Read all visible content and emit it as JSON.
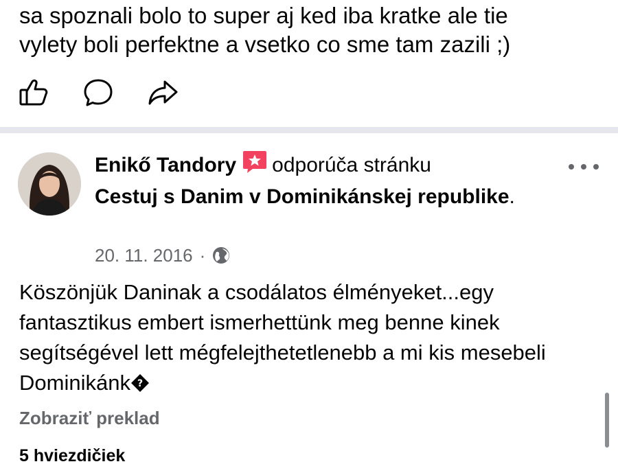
{
  "previous_post": {
    "text": "sa spoznali bolo to super aj ked iba kratke ale tie\nvylety boli perfektne a vsetko co sme tam zazili ;)"
  },
  "actions": [
    {
      "name": "like-icon"
    },
    {
      "name": "comment-icon"
    },
    {
      "name": "share-icon"
    }
  ],
  "review": {
    "author": "Enikő Tandory",
    "verb": "odporúča stránku",
    "page_name": "Cestuj s Danim v Dominikánskej republike",
    "page_suffix": ".",
    "date": "20. 11. 2016",
    "separator": "·",
    "privacy_icon": "globe-icon",
    "text": "Köszönjük Daninak a csodálatos élményeket...egy fantasztikus embert  ismerhettünk meg benne kinek segítségével lett mégfelejthetetlenebb a mi kis mesebeli Dominikánk",
    "translate_label": "Zobraziť preklad",
    "rating_label": "5 hviezdičiek"
  },
  "colors": {
    "recommend_badge": "#f3425f",
    "secondary_text": "#65676b",
    "divider": "#e4e6eb"
  }
}
